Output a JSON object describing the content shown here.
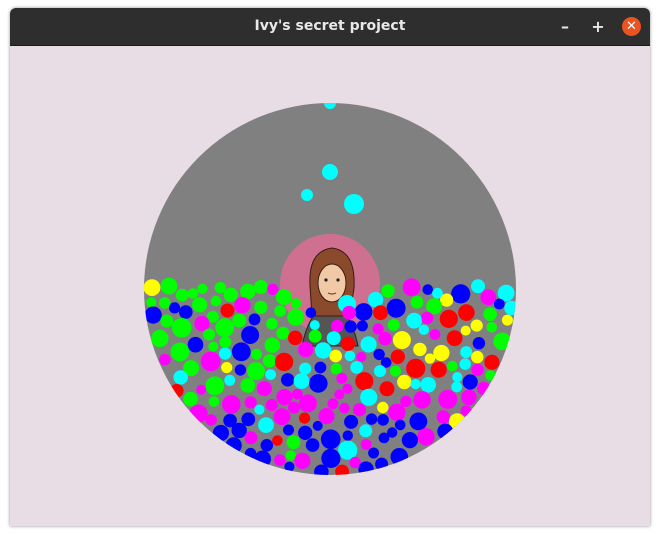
{
  "window": {
    "title": "Ivy's secret project",
    "buttons": {
      "minimize": "–",
      "maximize": "+",
      "close": "✕"
    }
  },
  "scene": {
    "colors": {
      "background": "#e8dde4",
      "bowl": "#808080",
      "halo": "#d07090",
      "hair": "#8b4a2b",
      "skin": "#f2c9a6",
      "jacket": "#555555",
      "balls": [
        "#ff0000",
        "#00ff00",
        "#ffff00",
        "#ff00ff",
        "#0000ff",
        "#00ffff"
      ]
    },
    "character": "girl-with-brown-hair"
  }
}
